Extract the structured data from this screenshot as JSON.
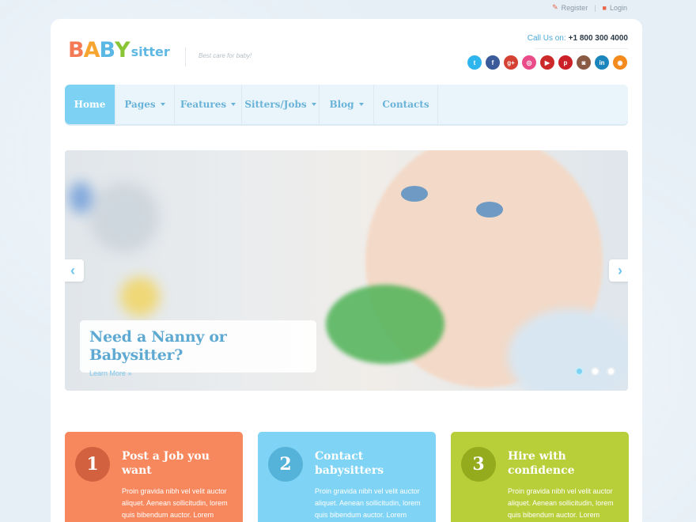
{
  "toplinks": {
    "register": "Register",
    "login": "Login"
  },
  "logo": {
    "letters": [
      "B",
      "A",
      "B",
      "Y"
    ],
    "letter_colors": [
      "#f47a56",
      "#f7a531",
      "#5bb8e4",
      "#8ac535"
    ],
    "sub": "sitter",
    "tagline": "Best care for baby!"
  },
  "contact": {
    "label": "Call Us on:",
    "phone": "+1 800 300 4000"
  },
  "socials": [
    {
      "icon": "twitter-icon",
      "glyph": "t",
      "color": "#2fb5ee"
    },
    {
      "icon": "facebook-icon",
      "glyph": "f",
      "color": "#3a5a99"
    },
    {
      "icon": "google-plus-icon",
      "glyph": "g+",
      "color": "#d44132"
    },
    {
      "icon": "dribbble-icon",
      "glyph": "◎",
      "color": "#ea4c89"
    },
    {
      "icon": "youtube-icon",
      "glyph": "▶",
      "color": "#cc2a2a"
    },
    {
      "icon": "pinterest-icon",
      "glyph": "p",
      "color": "#cb2027"
    },
    {
      "icon": "instagram-icon",
      "glyph": "◙",
      "color": "#8a5a44"
    },
    {
      "icon": "linkedin-icon",
      "glyph": "in",
      "color": "#1b86bd"
    },
    {
      "icon": "rss-icon",
      "glyph": "◉",
      "color": "#f28a1c"
    }
  ],
  "nav": [
    {
      "label": "Home",
      "active": true,
      "caret": false
    },
    {
      "label": "Pages",
      "active": false,
      "caret": true
    },
    {
      "label": "Features",
      "active": false,
      "caret": true
    },
    {
      "label": "Sitters/Jobs",
      "active": false,
      "caret": true
    },
    {
      "label": "Blog",
      "active": false,
      "caret": true
    },
    {
      "label": "Contacts",
      "active": false,
      "caret": false
    }
  ],
  "slider": {
    "heading": "Need a Nanny or Babysitter?",
    "link": "Learn More »",
    "prev": "‹",
    "next": "›",
    "slide_count": 3,
    "active_slide": 1
  },
  "cards": [
    {
      "number": "1",
      "title": "Post a Job you want",
      "text": "Proin gravida nibh vel velit auctor aliquet. Aenean sollicitudin, lorem quis bibendum auctor. Lorem",
      "color": "#f7885e",
      "circle": "#d2623f"
    },
    {
      "number": "2",
      "title": "Contact babysitters",
      "text": "Proin gravida nibh vel velit auctor aliquet. Aenean sollicitudin, lorem quis bibendum auctor. Lorem",
      "color": "#7fd3f4",
      "circle": "#55b3d9"
    },
    {
      "number": "3",
      "title": "Hire with confidence",
      "text": "Proin gravida nibh vel velit auctor aliquet. Aenean sollicitudin, lorem quis bibendum auctor. Lorem",
      "color": "#b8cf3a",
      "circle": "#93ab1c"
    }
  ]
}
